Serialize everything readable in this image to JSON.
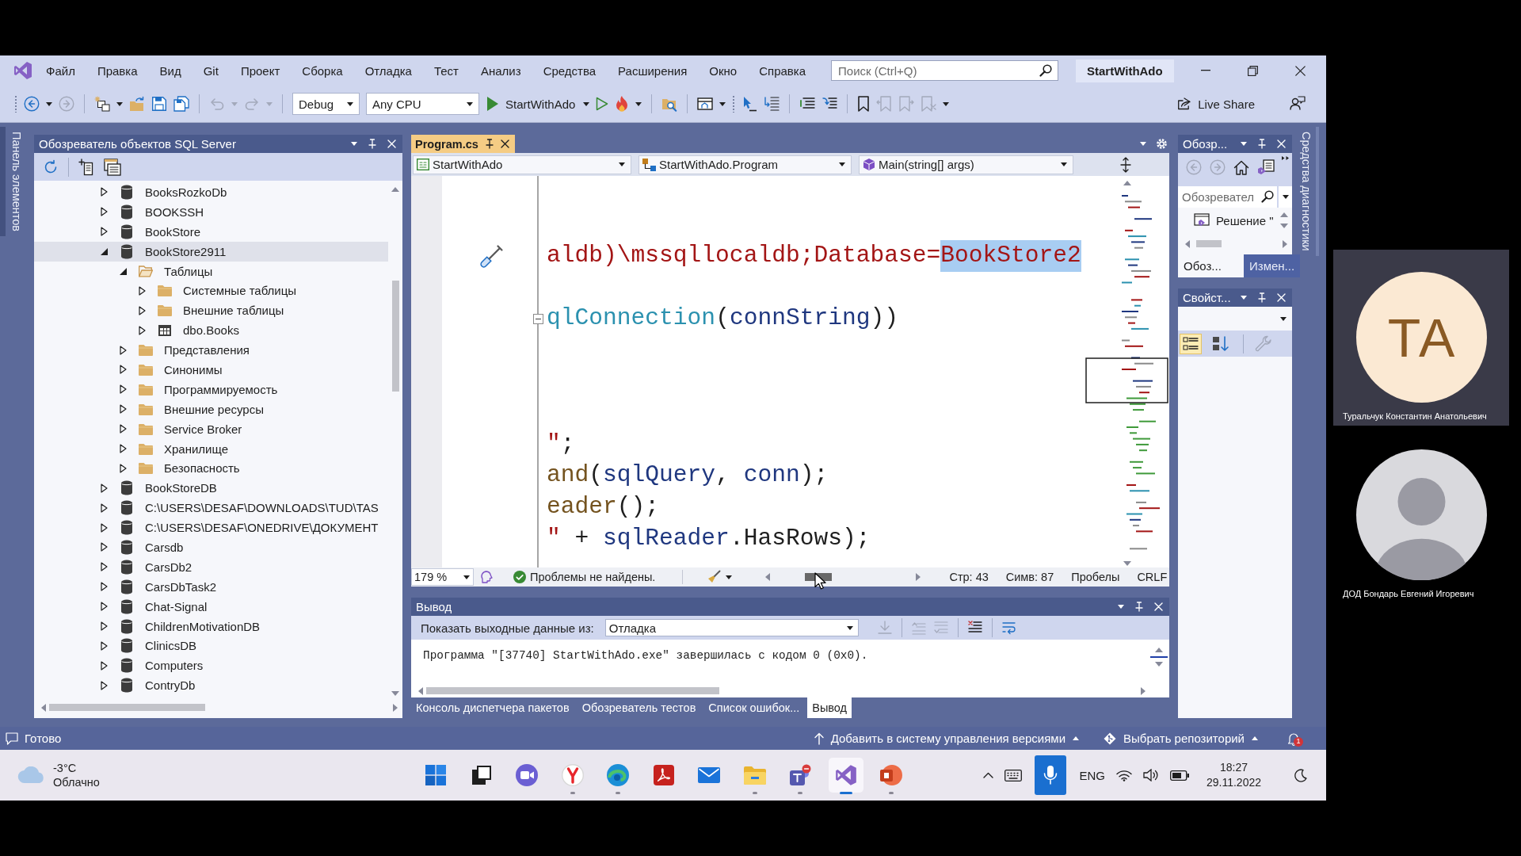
{
  "menu_bar": {
    "items": [
      "Файл",
      "Правка",
      "Вид",
      "Git",
      "Проект",
      "Сборка",
      "Отладка",
      "Тест",
      "Анализ",
      "Средства",
      "Расширения",
      "Окно",
      "Справка"
    ],
    "search": {
      "placeholder": "Поиск (Ctrl+Q)"
    },
    "solution_name": "StartWithAdo"
  },
  "toolbar": {
    "items": [
      {
        "kind": "gripper"
      },
      {
        "kind": "back",
        "disabled": false
      },
      {
        "kind": "caret",
        "disabled": false
      },
      {
        "kind": "forward",
        "disabled": true
      },
      {
        "kind": "separator"
      },
      {
        "kind": "new-project",
        "disabled": false
      },
      {
        "kind": "caret",
        "disabled": false
      },
      {
        "kind": "open-folder",
        "disabled": false
      },
      {
        "kind": "save",
        "disabled": false
      },
      {
        "kind": "save-all",
        "disabled": false
      },
      {
        "kind": "separator"
      },
      {
        "kind": "undo",
        "disabled": true
      },
      {
        "kind": "caret",
        "disabled": true
      },
      {
        "kind": "redo",
        "disabled": true
      },
      {
        "kind": "caret",
        "disabled": true
      },
      {
        "kind": "separator"
      },
      {
        "kind": "configuration",
        "value": "Debug"
      },
      {
        "kind": "platform",
        "value": "Any CPU"
      },
      {
        "kind": "start",
        "label": "StartWithAdo"
      },
      {
        "kind": "caret",
        "disabled": false
      },
      {
        "kind": "start-without-debugging",
        "disabled": false
      },
      {
        "kind": "hot-reload",
        "disabled": false
      },
      {
        "kind": "caret",
        "disabled": false
      },
      {
        "kind": "separator"
      },
      {
        "kind": "folder-search",
        "disabled": false
      },
      {
        "kind": "separator"
      },
      {
        "kind": "browser-window",
        "disabled": false
      },
      {
        "kind": "caret",
        "disabled": false
      },
      {
        "kind": "gripper"
      },
      {
        "kind": "pointer",
        "disabled": false
      },
      {
        "kind": "list-arrow",
        "disabled": false
      },
      {
        "kind": "separator"
      },
      {
        "kind": "comment",
        "disabled": false
      },
      {
        "kind": "uncomment",
        "disabled": false
      },
      {
        "kind": "separator"
      },
      {
        "kind": "bookmark",
        "disabled": false
      },
      {
        "kind": "bookmark-previous",
        "disabled": true
      },
      {
        "kind": "bookmark-next",
        "disabled": true
      },
      {
        "kind": "bookmark-clear",
        "disabled": true
      },
      {
        "kind": "caret",
        "disabled": false
      }
    ],
    "live_share": "Live Share"
  },
  "toolbox_tab": {
    "label": "Панель элементов"
  },
  "sql_explorer": {
    "title": "Обозреватель объектов SQL Server",
    "tools": [
      {
        "kind": "refresh"
      },
      {
        "kind": "separator"
      },
      {
        "kind": "add-server"
      },
      {
        "kind": "new-query"
      }
    ],
    "tree": [
      {
        "label": "BooksRozkoDb",
        "kind": "database",
        "expanded": false,
        "selected": false
      },
      {
        "label": "BOOKSSH",
        "kind": "database",
        "expanded": false,
        "selected": false
      },
      {
        "label": "BookStore",
        "kind": "database",
        "expanded": false,
        "selected": false
      },
      {
        "label": "BookStore2911",
        "kind": "database",
        "expanded": true,
        "selected": true,
        "children": [
          {
            "label": "Таблицы",
            "kind": "folder",
            "expanded": true,
            "selected": false,
            "children": [
              {
                "label": "Системные таблицы",
                "kind": "folder",
                "expanded": false,
                "selected": false
              },
              {
                "label": "Внешние таблицы",
                "kind": "folder",
                "expanded": false,
                "selected": false
              },
              {
                "label": "dbo.Books",
                "kind": "table",
                "expanded": false,
                "selected": false
              }
            ]
          },
          {
            "label": "Представления",
            "kind": "folder",
            "expanded": false,
            "selected": false
          },
          {
            "label": "Синонимы",
            "kind": "folder",
            "expanded": false,
            "selected": false
          },
          {
            "label": "Программируемость",
            "kind": "folder",
            "expanded": false,
            "selected": false
          },
          {
            "label": "Внешние ресурсы",
            "kind": "folder",
            "expanded": false,
            "selected": false
          },
          {
            "label": "Service Broker",
            "kind": "folder",
            "expanded": false,
            "selected": false
          },
          {
            "label": "Хранилище",
            "kind": "folder",
            "expanded": false,
            "selected": false
          },
          {
            "label": "Безопасность",
            "kind": "folder",
            "expanded": false,
            "selected": false
          }
        ]
      },
      {
        "label": "BookStoreDB",
        "kind": "database",
        "expanded": false,
        "selected": false
      },
      {
        "label": "C:\\USERS\\DESAF\\DOWNLOADS\\TUD\\TAS",
        "kind": "database",
        "expanded": false,
        "selected": false
      },
      {
        "label": "C:\\USERS\\DESAF\\ONEDRIVE\\ДОКУМЕНТ",
        "kind": "database",
        "expanded": false,
        "selected": false
      },
      {
        "label": "Carsdb",
        "kind": "database",
        "expanded": false,
        "selected": false
      },
      {
        "label": "CarsDb2",
        "kind": "database",
        "expanded": false,
        "selected": false
      },
      {
        "label": "CarsDbTask2",
        "kind": "database",
        "expanded": false,
        "selected": false
      },
      {
        "label": "Chat-Signal",
        "kind": "database",
        "expanded": false,
        "selected": false
      },
      {
        "label": "ChildrenMotivationDB",
        "kind": "database",
        "expanded": false,
        "selected": false
      },
      {
        "label": "ClinicsDB",
        "kind": "database",
        "expanded": false,
        "selected": false
      },
      {
        "label": "Computers",
        "kind": "database",
        "expanded": false,
        "selected": false
      },
      {
        "label": "ContryDb",
        "kind": "database",
        "expanded": false,
        "selected": false
      }
    ]
  },
  "editor": {
    "tab": {
      "label": "Program.cs",
      "selected": true
    },
    "navigation": [
      {
        "kind": "project",
        "value": "StartWithAdo"
      },
      {
        "kind": "class",
        "value": "StartWithAdo.Program"
      },
      {
        "kind": "method",
        "value": "Main(string[] args)"
      }
    ],
    "lines": [
      {
        "kind": "blank"
      },
      {
        "kind": "blank"
      },
      {
        "kind": "code",
        "quick_actions": true,
        "fold_box": false,
        "tokens": [
          {
            "kind": "string",
            "text": "aldb)\\mssqllocaldb;Database="
          },
          {
            "kind": "selection",
            "text": "BookStore2"
          }
        ]
      },
      {
        "kind": "blank"
      },
      {
        "kind": "code",
        "quick_actions": false,
        "fold_box": true,
        "tokens": [
          {
            "kind": "type",
            "text": "qlConnection"
          },
          {
            "kind": "plain",
            "text": "("
          },
          {
            "kind": "variable",
            "text": "connString"
          },
          {
            "kind": "plain",
            "text": "))"
          }
        ]
      },
      {
        "kind": "blank"
      },
      {
        "kind": "blank"
      },
      {
        "kind": "blank"
      },
      {
        "kind": "code",
        "quick_actions": false,
        "fold_box": false,
        "tokens": [
          {
            "kind": "string",
            "text": "\""
          },
          {
            "kind": "plain",
            "text": ";"
          }
        ]
      },
      {
        "kind": "code",
        "quick_actions": false,
        "fold_box": false,
        "tokens": [
          {
            "kind": "method",
            "text": "and"
          },
          {
            "kind": "plain",
            "text": "("
          },
          {
            "kind": "variable",
            "text": "sqlQuery"
          },
          {
            "kind": "plain",
            "text": ", "
          },
          {
            "kind": "variable",
            "text": "conn"
          },
          {
            "kind": "plain",
            "text": ");"
          }
        ]
      },
      {
        "kind": "code",
        "quick_actions": false,
        "fold_box": false,
        "tokens": [
          {
            "kind": "method",
            "text": "eader"
          },
          {
            "kind": "plain",
            "text": "();"
          }
        ]
      },
      {
        "kind": "code",
        "quick_actions": false,
        "fold_box": false,
        "tokens": [
          {
            "kind": "string",
            "text": "\""
          },
          {
            "kind": "plain",
            "text": " + "
          },
          {
            "kind": "variable",
            "text": "sqlReader"
          },
          {
            "kind": "plain",
            "text": ".HasRows);"
          }
        ]
      }
    ],
    "status": {
      "zoom": "179 %",
      "issues": "Проблемы не найдены.",
      "line": "Стр: 43",
      "column": "Симв: 87",
      "whitespace": "Пробелы",
      "line_ending": "CRLF"
    }
  },
  "output": {
    "title": "Вывод",
    "source_label": "Показать выходные данные из:",
    "source": "Отладка",
    "tools": [
      {
        "kind": "find-in-code",
        "disabled": true
      },
      {
        "kind": "separator"
      },
      {
        "kind": "previous-message",
        "disabled": true
      },
      {
        "kind": "next-message",
        "disabled": true
      },
      {
        "kind": "separator"
      },
      {
        "kind": "clear-all",
        "disabled": false
      },
      {
        "kind": "separator"
      },
      {
        "kind": "word-wrap",
        "disabled": false
      }
    ],
    "text": "Программа \"[37740] StartWithAdo.exe\" завершилась с кодом 0 (0x0).",
    "tabs": [
      {
        "label": "Консоль диспетчера пакетов",
        "selected": false
      },
      {
        "label": "Обозреватель тестов",
        "selected": false
      },
      {
        "label": "Список ошибок...",
        "selected": false
      },
      {
        "label": "Вывод",
        "selected": true
      }
    ]
  },
  "solution_explorer": {
    "title": "Обозр...",
    "tools": [
      {
        "kind": "back",
        "disabled": true
      },
      {
        "kind": "forward",
        "disabled": true
      },
      {
        "kind": "home",
        "disabled": false
      },
      {
        "kind": "solution-view",
        "disabled": false
      }
    ],
    "search": {
      "placeholder": "Обозревател"
    },
    "items": [
      {
        "label": "Решение \"",
        "selected": false
      }
    ],
    "tabs": [
      {
        "label": "Обоз...",
        "selected": true
      },
      {
        "label": "Измен...",
        "selected": false
      }
    ]
  },
  "properties": {
    "title": "Свойст...",
    "tools": [
      {
        "kind": "categorized",
        "selected": true
      },
      {
        "kind": "alphabetical",
        "selected": false
      },
      {
        "kind": "separator"
      },
      {
        "kind": "property-pages",
        "disabled": true
      }
    ]
  },
  "diagnostics_tab": {
    "label": "Средства диагностики"
  },
  "status_bar": {
    "state": "Готово",
    "source_control": "Добавить в систему управления версиями",
    "repository": "Выбрать репозиторий",
    "notifications": "1"
  },
  "taskbar": {
    "weather": {
      "temperature": "-3°C",
      "condition": "Облачно"
    },
    "apps": [
      {
        "kind": "start",
        "running": false,
        "selected": false
      },
      {
        "kind": "task-view",
        "running": false,
        "selected": false
      },
      {
        "kind": "video-chat",
        "running": false,
        "selected": false
      },
      {
        "kind": "y-browser",
        "running": true,
        "selected": false
      },
      {
        "kind": "browser",
        "running": true,
        "selected": false
      },
      {
        "kind": "pdf",
        "running": false,
        "selected": false
      },
      {
        "kind": "mail",
        "running": false,
        "selected": false
      },
      {
        "kind": "files",
        "running": true,
        "selected": false
      },
      {
        "kind": "team-chat",
        "running": true,
        "selected": false
      },
      {
        "kind": "ide",
        "running": true,
        "selected": true
      },
      {
        "kind": "slides",
        "running": true,
        "selected": false
      }
    ],
    "language": "ENG",
    "time": "18:27",
    "date": "29.11.2022"
  },
  "call": {
    "participants": [
      {
        "kind": "initials",
        "initials": "ТА",
        "name": "Туральчук Константин Анатольевич"
      },
      {
        "kind": "photo",
        "name": "ДОД Бондарь Евгений Игоревич"
      }
    ]
  }
}
